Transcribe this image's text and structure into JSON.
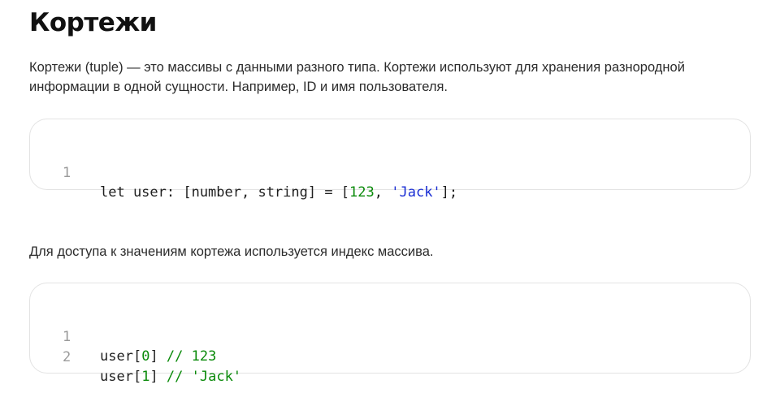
{
  "article": {
    "title": "Кортежи",
    "intro": "Кортежи (tuple) — это массивы с данными разного типа. Кортежи используют для хранения разнородной информации в одной сущности. Например, ID и имя пользователя.",
    "access_text": "Для доступа к значениям кортежа используется индекс массива."
  },
  "code_block_1": {
    "lines": [
      {
        "number": "1",
        "tokens": {
          "a": "let user: [number, string] = [",
          "num": "123",
          "b": ", ",
          "str": "'Jack'",
          "c": "];"
        }
      }
    ]
  },
  "code_block_2": {
    "lines": [
      {
        "number": "1",
        "tokens": {
          "a": "user[",
          "idx": "0",
          "b": "] ",
          "comment": "// 123"
        }
      },
      {
        "number": "2",
        "tokens": {
          "a": "user[",
          "idx": "1",
          "b": "] ",
          "comment": "// 'Jack'"
        }
      }
    ]
  },
  "colors": {
    "number": "#0a8a0a",
    "string": "#1a2ed4",
    "comment": "#0a8a0a",
    "line_number": "#9a9a9a",
    "border": "#e3e3e3"
  }
}
